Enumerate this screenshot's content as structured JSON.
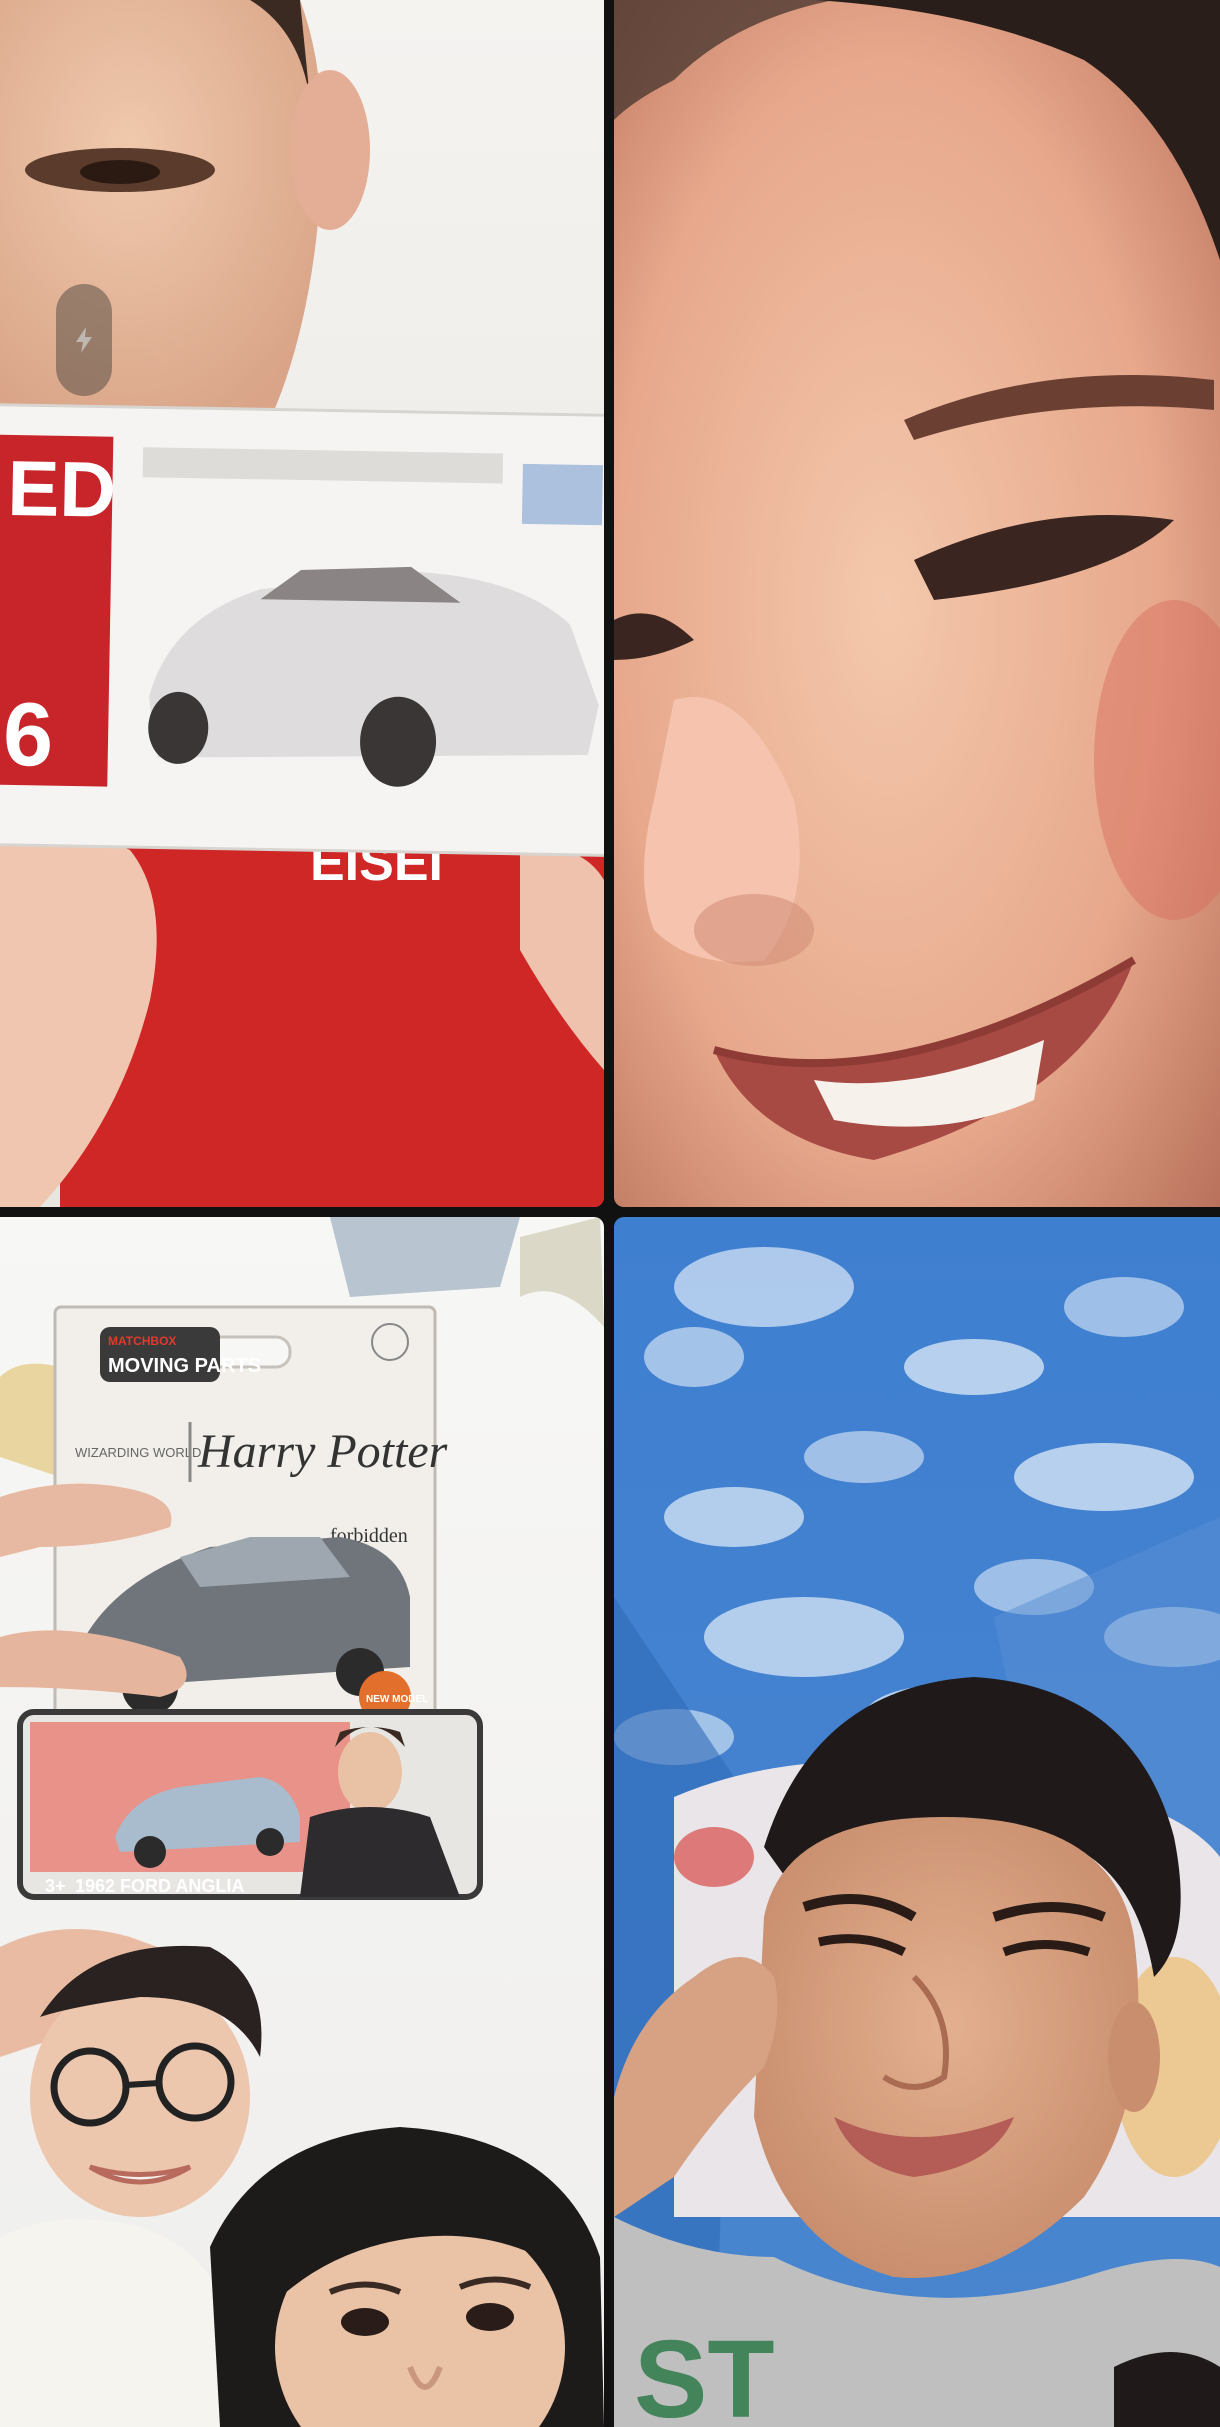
{
  "call": {
    "layout": "2x2-grid",
    "participants": [
      {
        "id": "participant-1",
        "content": "boy holding toy car box"
      },
      {
        "id": "participant-2",
        "content": "smiling face close-up"
      },
      {
        "id": "participant-3",
        "content": "two people holding Harry Potter car"
      },
      {
        "id": "participant-4",
        "content": "man lying on bed"
      }
    ]
  },
  "flash_button": {
    "icon": "flash-off-icon"
  },
  "tile3": {
    "package_brand": "MOVING PARTS",
    "package_brand_top": "MATCHBOX",
    "package_series_left": "WIZARDING WORLD",
    "package_title": "Harry Potter",
    "package_word": "forbidden",
    "package_model": "1962 FORD ANGLIA",
    "package_age": "3+",
    "package_badge": "NEW MODEL"
  },
  "colors": {
    "background": "#111111",
    "shirt_red": "#d42a2a",
    "sky_blue": "#3d7fd0"
  }
}
